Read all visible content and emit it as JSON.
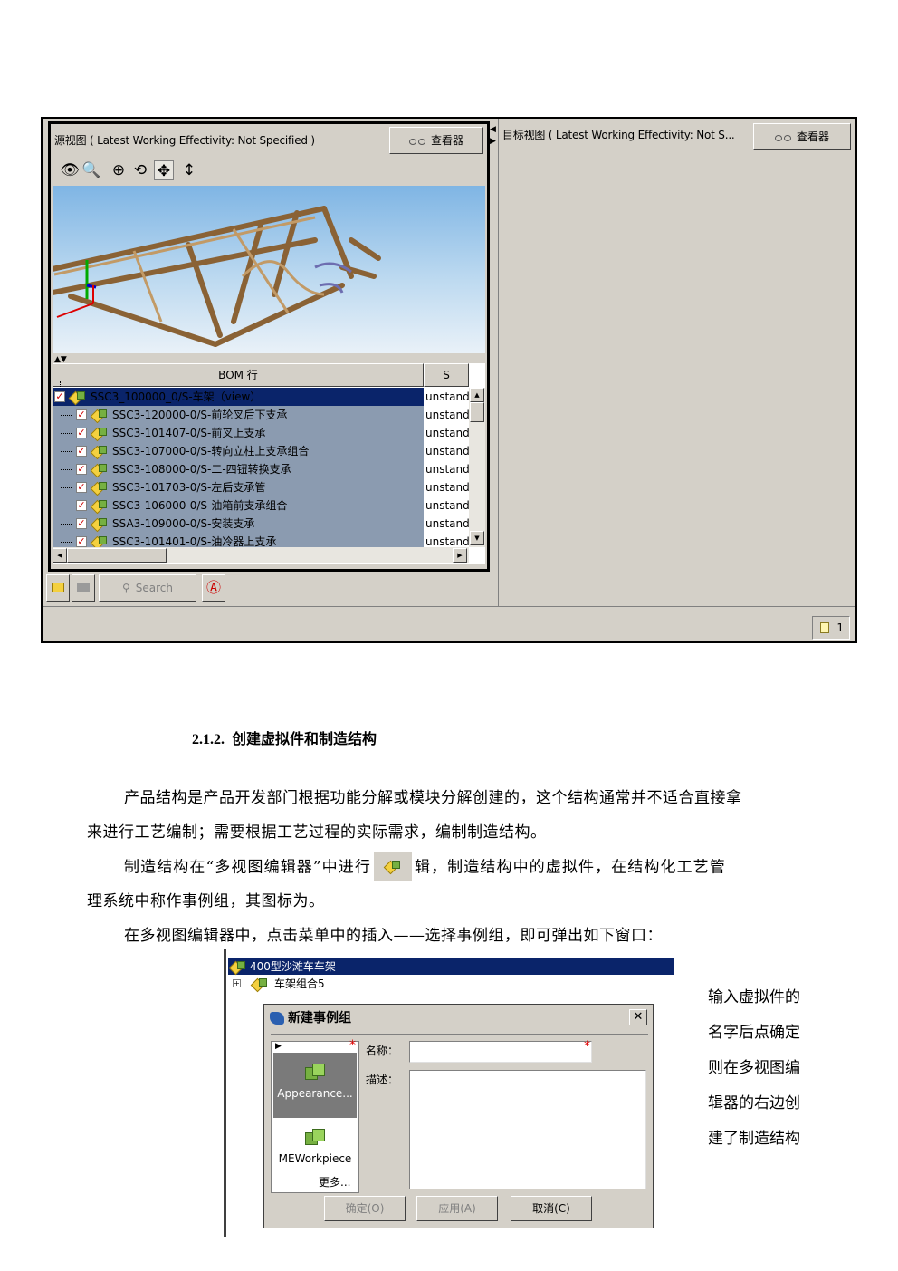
{
  "screenshot": {
    "source_header": "源视图 ( Latest Working Effectivity: Not Specified )",
    "target_header": "目标视图 ( Latest Working Effectivity: Not S...",
    "viewer_label": "查看器",
    "bom_column": "BOM 行",
    "status_column": "S",
    "rows": [
      {
        "name": "SSC3_100000_0/S-车架（view）",
        "status": "unstand"
      },
      {
        "name": "SSC3-120000-0/S-前轮叉后下支承",
        "status": "unstand"
      },
      {
        "name": "SSC3-101407-0/S-前叉上支承",
        "status": "unstand"
      },
      {
        "name": "SSC3-107000-0/S-转向立柱上支承组合",
        "status": "unstand"
      },
      {
        "name": "SSC3-108000-0/S-二-四钮转换支承",
        "status": "unstand"
      },
      {
        "name": "SSC3-101703-0/S-左后支承管",
        "status": "unstand"
      },
      {
        "name": "SSC3-106000-0/S-油箱前支承组合",
        "status": "unstand"
      },
      {
        "name": "SSA3-109000-0/S-安装支承",
        "status": "unstand"
      },
      {
        "name": "SSC3-101401-0/S-油冷器上支承",
        "status": "unstand"
      }
    ],
    "search_label": "Search",
    "page_count": "1"
  },
  "doc": {
    "heading_num": "2.1.2.",
    "heading_text": "创建虚拟件和制造结构",
    "p1_line1": "产品结构是产品开发部门根据功能分解或模块分解创建的，这个结构通常并不适合直接拿",
    "p1_line2": "来进行工艺编制；需要根据工艺过程的实际需求，编制制造结构。",
    "p2_before": "制造结构在“多视图编辑器”中进行",
    "p2_after": "辑，制造结构中的虚拟件，在结构化工艺管",
    "p2_line2": "理系统中称作事例组，其图标为。",
    "p3": "在多视图编辑器中，点击菜单中的插入——选择事例组，即可弹出如下窗口："
  },
  "dialog_shot": {
    "tree_root": "400型沙滩车车架",
    "tree_child": "车架组合5",
    "dialog_title": "新建事例组",
    "close_glyph": "✕",
    "type1": "Appearance...",
    "type2": "MEWorkpiece",
    "more": "更多...",
    "name_label": "名称：",
    "desc_label": "描述：",
    "ok": "确定(O)",
    "apply": "应用(A)",
    "cancel": "取消(C)"
  },
  "side_note": [
    "输入虚拟件的",
    "名字后点确定",
    "则在多视图编",
    "辑器的右边创",
    "建了制造结构"
  ]
}
